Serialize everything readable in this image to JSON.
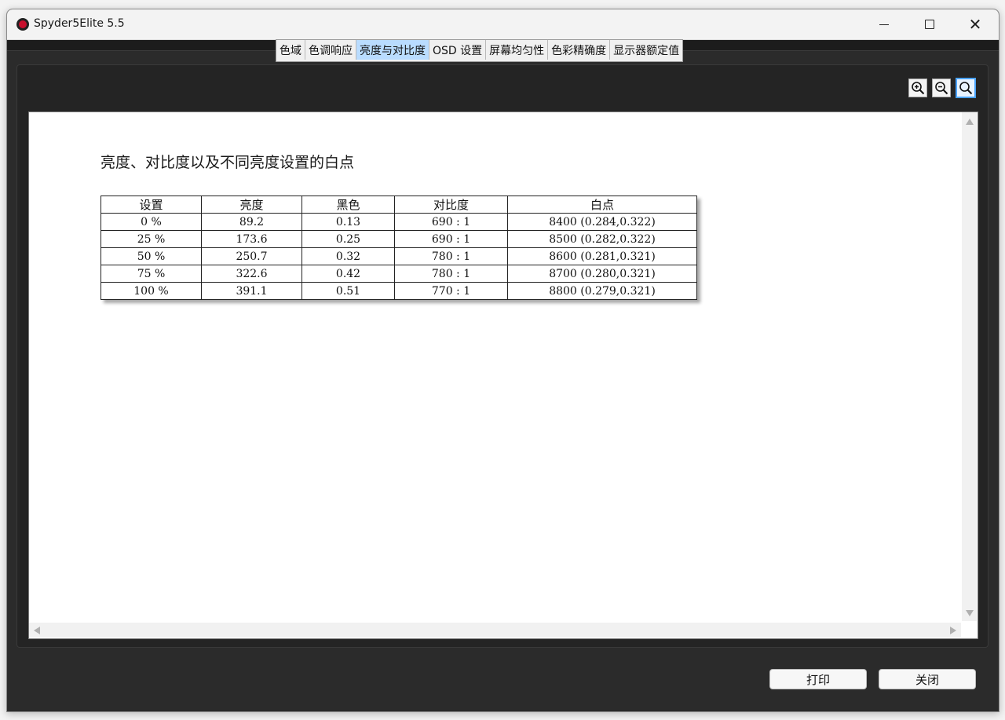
{
  "window": {
    "title": "Spyder5Elite 5.5",
    "icon": "spyder-logo-icon",
    "controls": [
      "minimize",
      "maximize",
      "close"
    ]
  },
  "tabs": [
    {
      "label": "色域",
      "active": false
    },
    {
      "label": "色调响应",
      "active": false
    },
    {
      "label": "亮度与对比度",
      "active": true
    },
    {
      "label": "OSD 设置",
      "active": false
    },
    {
      "label": "屏幕均匀性",
      "active": false
    },
    {
      "label": "色彩精确度",
      "active": false
    },
    {
      "label": "显示器额定值",
      "active": false
    }
  ],
  "toolbar": {
    "zoom_in_icon": "zoom-in-icon",
    "zoom_out_icon": "zoom-out-icon",
    "zoom_fit_icon": "zoom-fit-icon"
  },
  "report": {
    "title": "亮度、对比度以及不同亮度设置的白点",
    "headers": [
      "设置",
      "亮度",
      "黑色",
      "对比度",
      "白点"
    ],
    "rows": [
      [
        "0 %",
        "89.2",
        "0.13",
        "690 : 1",
        "8400 (0.284,0.322)"
      ],
      [
        "25 %",
        "173.6",
        "0.25",
        "690 : 1",
        "8500 (0.282,0.322)"
      ],
      [
        "50 %",
        "250.7",
        "0.32",
        "780 : 1",
        "8600 (0.281,0.321)"
      ],
      [
        "75 %",
        "322.6",
        "0.42",
        "780 : 1",
        "8700 (0.280,0.321)"
      ],
      [
        "100 %",
        "391.1",
        "0.51",
        "770 : 1",
        "8800 (0.279,0.321)"
      ]
    ]
  },
  "footer": {
    "print_label": "打印",
    "close_label": "关闭"
  },
  "colors": {
    "active_tab": "#b9dcff",
    "frame": "#2b2b2b",
    "zoom_fit_border": "#4aa3ff"
  }
}
